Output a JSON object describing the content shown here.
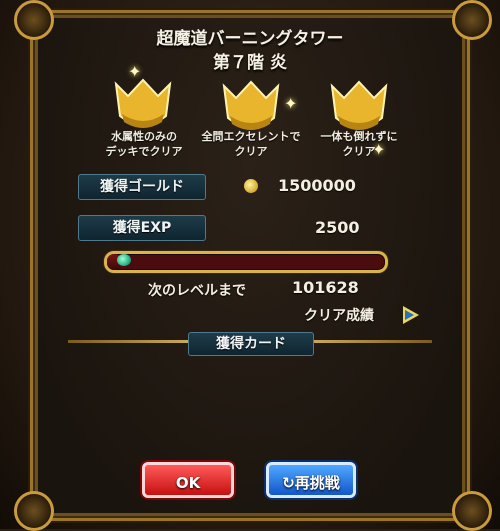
{
  "header": {
    "title": "超魔道バーニングタワー",
    "subtitle": "第７階 炎"
  },
  "missions": [
    {
      "label_line1": "水属性のみの",
      "label_line2": "デッキでクリア"
    },
    {
      "label_line1": "全問エクセレントで",
      "label_line2": "クリア"
    },
    {
      "label_line1": "一体も倒れずに",
      "label_line2": "クリア"
    }
  ],
  "rewards": {
    "gold_label": "獲得ゴールド",
    "gold_value": "1500000",
    "exp_label": "獲得EXP",
    "exp_value": "2500",
    "next_level_label": "次のレベルまで",
    "next_level_value": "101628",
    "exp_progress": 0.05
  },
  "links": {
    "clear_result": "クリア成績"
  },
  "cards": {
    "label": "獲得カード"
  },
  "buttons": {
    "ok": "OK",
    "retry": "再挑戦",
    "retry_icon": "↻"
  },
  "colors": {
    "frame_gold": "#c99a3e",
    "ok_red": "#e02a2a",
    "retry_blue": "#2a7ae0",
    "label_teal": "#1e3b49"
  }
}
